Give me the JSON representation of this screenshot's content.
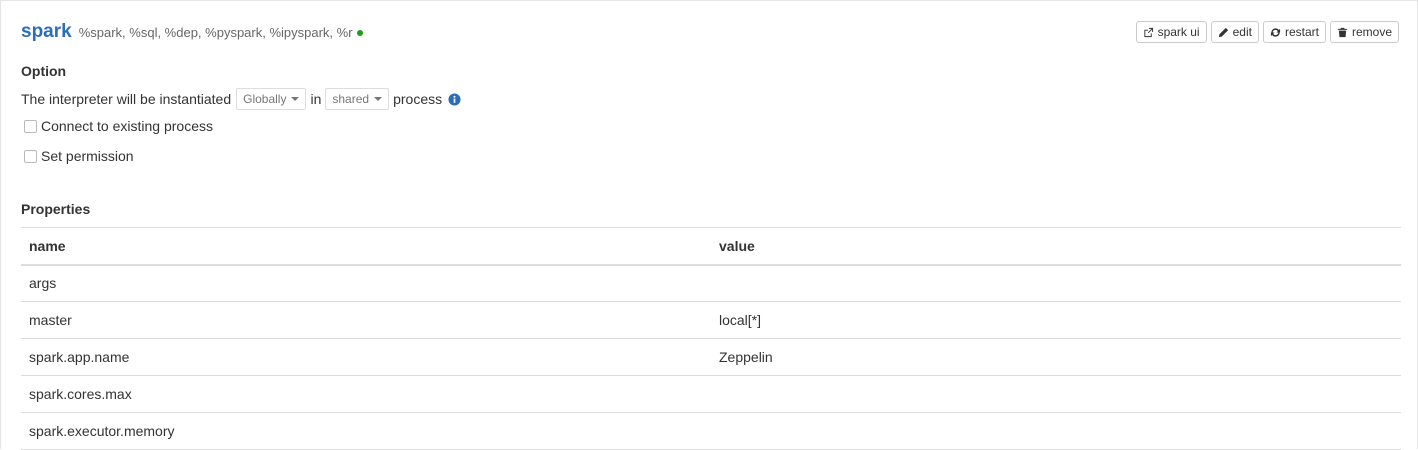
{
  "interpreter": {
    "name": "spark",
    "groups": "%spark, %sql, %dep, %pyspark, %ipyspark, %r",
    "status_color": "#1a9e1a"
  },
  "actions": {
    "spark_ui": "spark ui",
    "edit": "edit",
    "restart": "restart",
    "remove": "remove"
  },
  "option": {
    "title": "Option",
    "instantiated_prefix": "The interpreter will be instantiated",
    "scope_value": "Globally",
    "in_label": "in",
    "process_mode_value": "shared",
    "process_label": "process",
    "connect_existing_label": "Connect to existing process",
    "set_permission_label": "Set permission"
  },
  "properties": {
    "title": "Properties",
    "columns": [
      "name",
      "value"
    ],
    "rows": [
      {
        "name": "args",
        "value": ""
      },
      {
        "name": "master",
        "value": "local[*]"
      },
      {
        "name": "spark.app.name",
        "value": "Zeppelin"
      },
      {
        "name": "spark.cores.max",
        "value": ""
      },
      {
        "name": "spark.executor.memory",
        "value": ""
      }
    ]
  },
  "colors": {
    "accent": "#2a6ebb",
    "status_running": "#1a9e1a"
  },
  "icons": {
    "spark_ui": "external-link-icon",
    "edit": "pencil-icon",
    "restart": "refresh-icon",
    "remove": "trash-icon",
    "info": "info-circle-icon"
  }
}
